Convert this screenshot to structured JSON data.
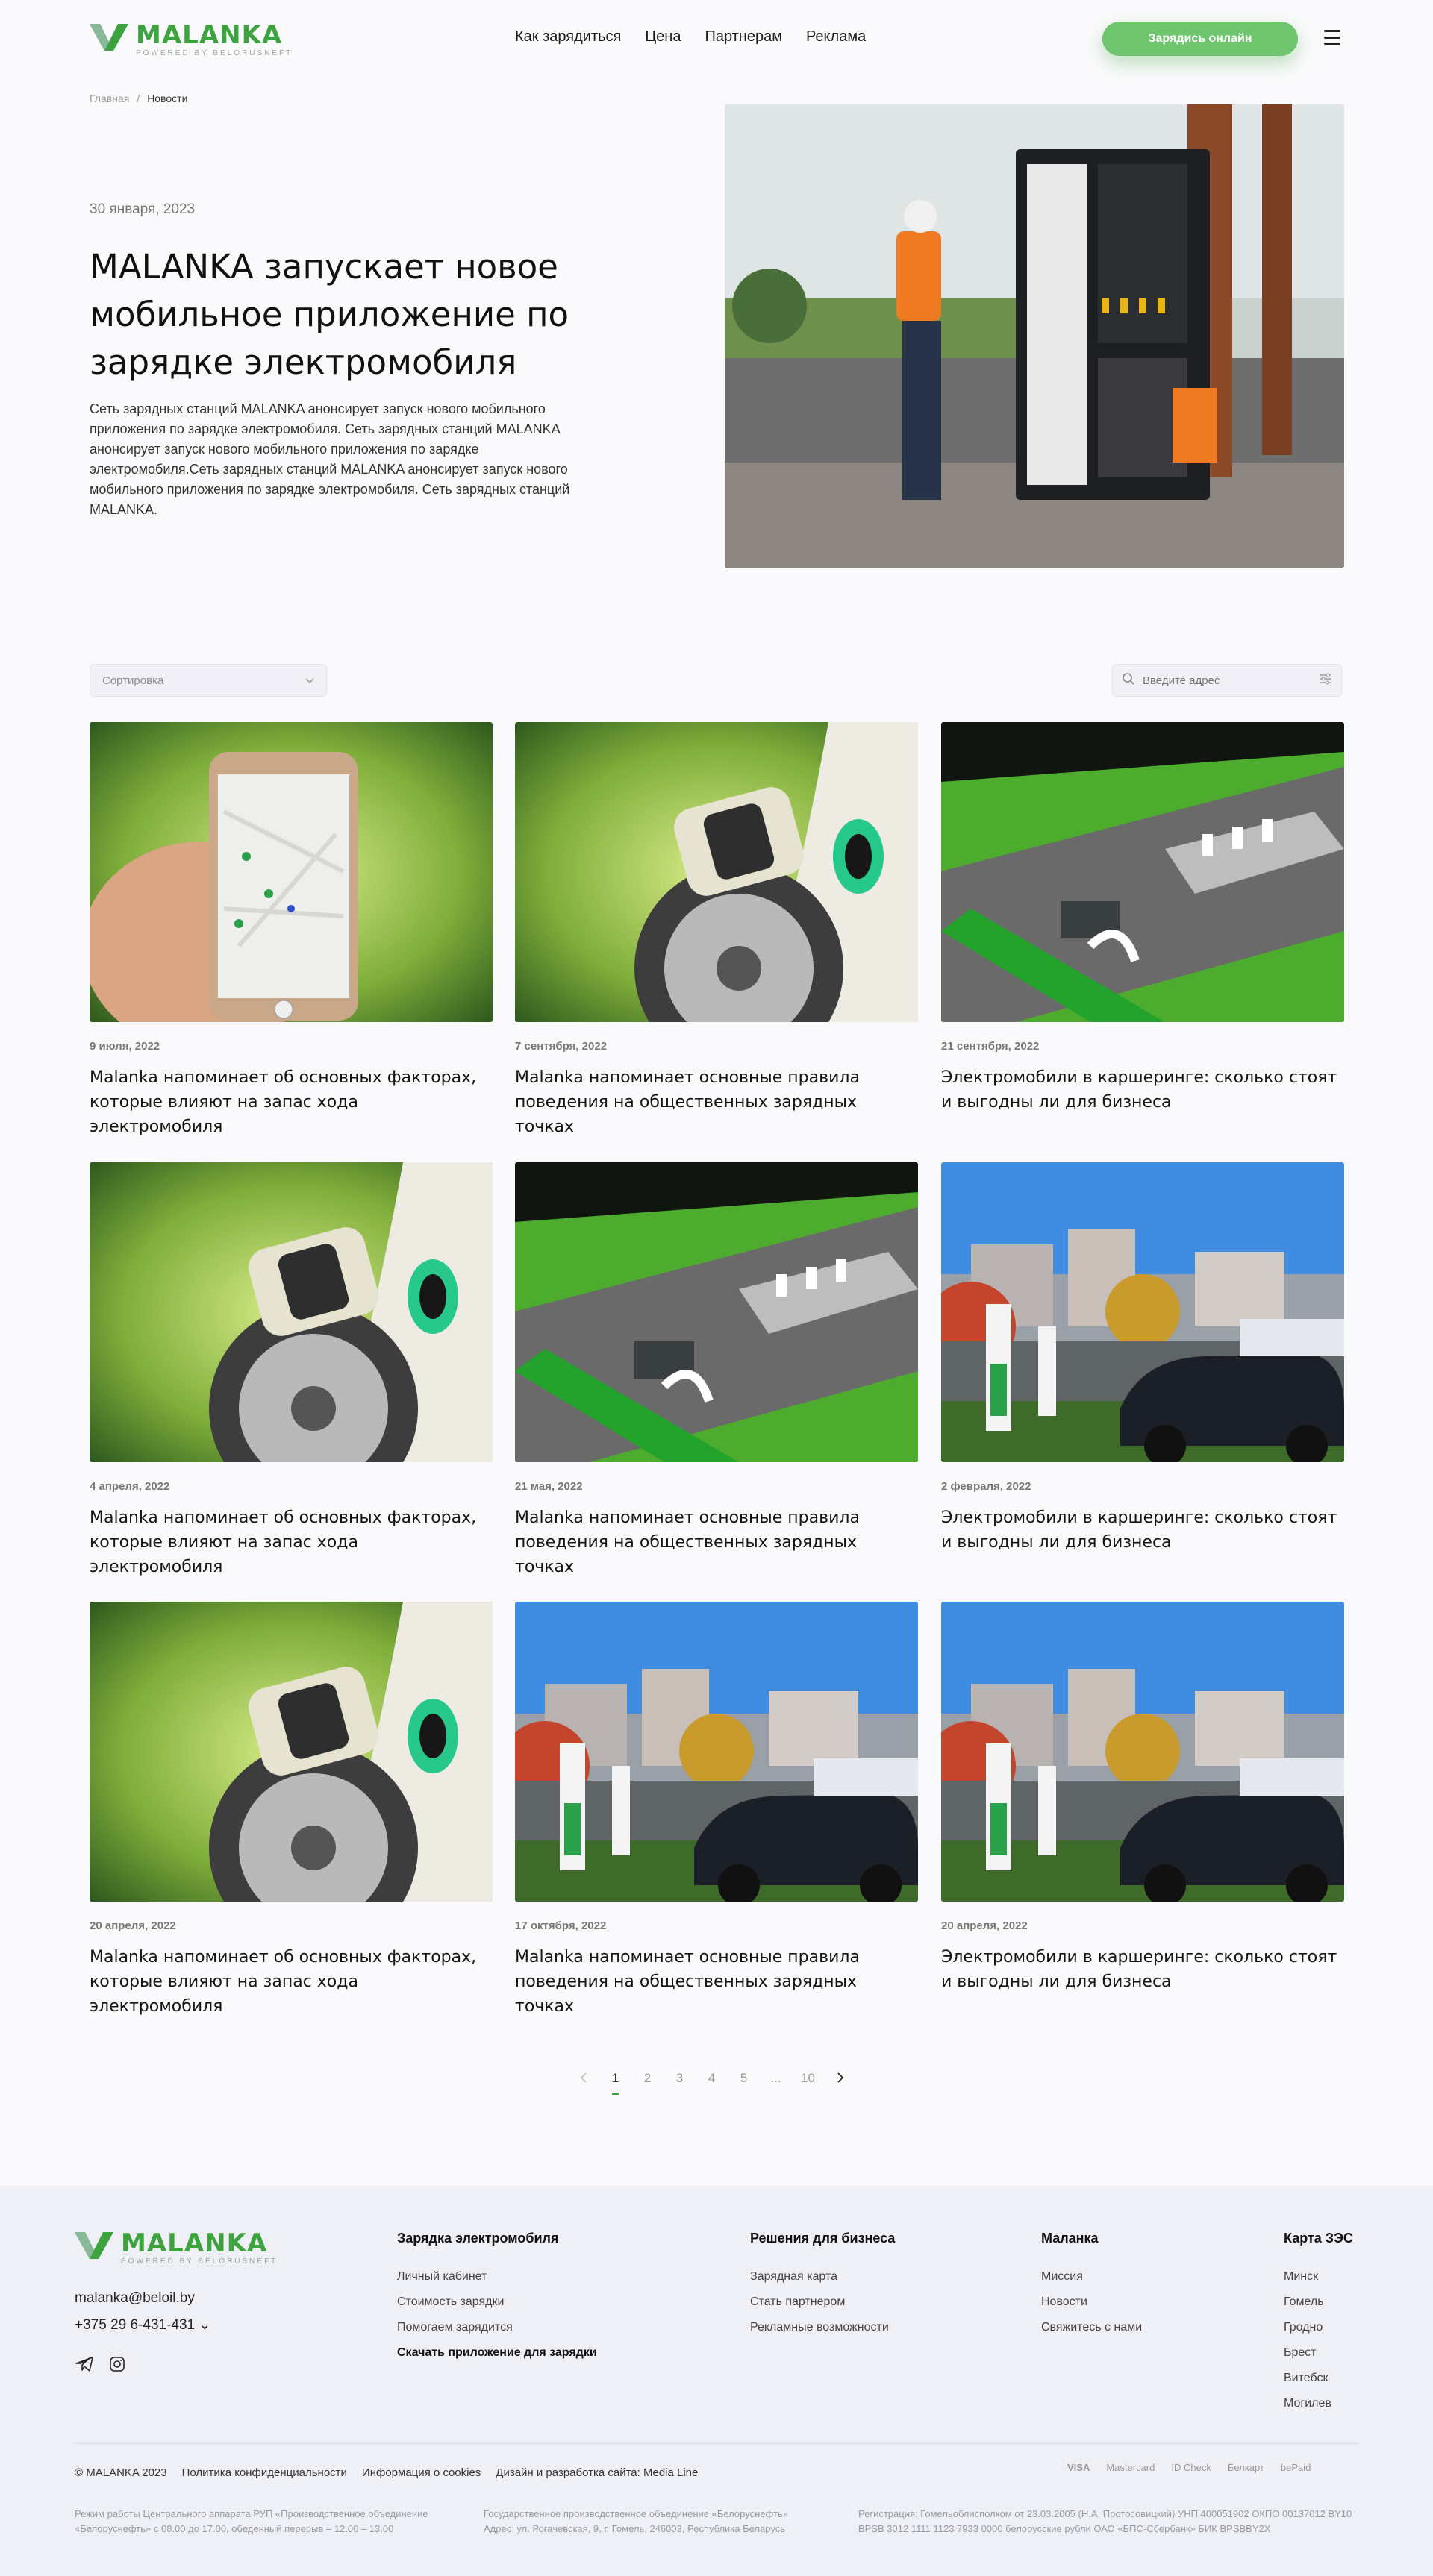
{
  "brand": {
    "name": "MALANKA",
    "tagline": "POWERED BY BELORUSNEFT",
    "green": "#3ca33f",
    "green_light": "#6fc46e"
  },
  "header": {
    "nav": [
      "Как зарядиться",
      "Цена",
      "Партнерам",
      "Реклама"
    ],
    "cta": "Зарядись онлайн",
    "menu_icon": "hamburger-icon"
  },
  "breadcrumb": {
    "home": "Главная",
    "separator": "/",
    "current": "Новости"
  },
  "hero": {
    "date": "30 января, 2023",
    "title": "MALANKA запускает новое мобильное приложение по зарядке электромобиля",
    "text": "Сеть зарядных станций MALANKA анонсирует запуск нового мобильного приложения по зарядке электромобиля. Сеть зарядных станций MALANKA анонсирует запуск нового мобильного приложения по зарядке электромобиля.Сеть зарядных станций MALANKA анонсирует запуск нового мобильного приложения по зарядке электромобиля. Сеть зарядных станций MALANKA."
  },
  "filters": {
    "sort_label": "Сортировка",
    "search_placeholder": "Введите адрес"
  },
  "cards": [
    {
      "date": "9 июля, 2022",
      "title": "Malanka напоминает об основных факторах, которые влияют на запас хода электромобиля",
      "image": "phone-map"
    },
    {
      "date": "7 сентября, 2022",
      "title": "Malanka напоминает основные правила поведения на общественных зарядных точках",
      "image": "charging-plug"
    },
    {
      "date": "21 сентября, 2022",
      "title": "Электромобили в каршеринге: сколько стоят и выгодны ли для бизнеса",
      "image": "station-render"
    },
    {
      "date": "4 апреля, 2022",
      "title": "Malanka напоминает об основных факторах, которые влияют на запас хода электромобиля",
      "image": "charging-plug"
    },
    {
      "date": "21 мая, 2022",
      "title": "Malanka напоминает основные правила поведения на общественных зарядных точках",
      "image": "station-render"
    },
    {
      "date": "2 февраля, 2022",
      "title": "Электромобили в каршеринге: сколько стоят и выгодны ли для бизнеса",
      "image": "street-chargers"
    },
    {
      "date": "20 апреля, 2022",
      "title": "Malanka напоминает об основных факторах, которые влияют на запас хода электромобиля",
      "image": "charging-plug"
    },
    {
      "date": "17 октября, 2022",
      "title": "Malanka напоминает основные правила поведения на общественных зарядных точках",
      "image": "street-chargers"
    },
    {
      "date": "20 апреля, 2022",
      "title": "Электромобили в каршеринге: сколько стоят и выгодны ли для бизнеса",
      "image": "street-chargers"
    }
  ],
  "pagination": {
    "pages": [
      "1",
      "2",
      "3",
      "4",
      "5",
      "...",
      "10"
    ],
    "current": "1"
  },
  "footer": {
    "email": "malanka@beloil.by",
    "phone": "+375 29 6-431-431",
    "social": [
      "telegram-icon",
      "instagram-icon"
    ],
    "columns": [
      {
        "title": "Зарядка электромобиля",
        "links": [
          "Личный кабинет",
          "Стоимость зарядки",
          "Помогаем зарядится",
          "Скачать приложение для зарядки"
        ]
      },
      {
        "title": "Решения для бизнеса",
        "links": [
          "Зарядная карта",
          "Стать партнером",
          "Рекламные возможности"
        ]
      },
      {
        "title": "Маланка",
        "links": [
          "Миссия",
          "Новости",
          "Свяжитесь с нами"
        ]
      },
      {
        "title": "Карта ЗЭС",
        "links": [
          "Минск",
          "Гомель",
          "Гродно",
          "Брест",
          "Витебск",
          "Могилев"
        ]
      }
    ],
    "bottom": [
      "© MALANKA 2023",
      "Политика конфиденциальности",
      "Информация о cookies",
      "Дизайн и разработка сайта: Media Line"
    ],
    "payments": [
      "VISA",
      "Mastercard",
      "ID Check",
      "Белкарт",
      "bePaid"
    ],
    "legal": [
      "Режим работы Центрального аппарата РУП «Производственное объединение «Белоруснефть» с 08.00 до 17.00, обеденный перерыв – 12.00 – 13.00",
      "Государственное производственное объединение «Белоруснефть» Адрес: ул. Рогачевская, 9, г. Гомель, 246003, Республика Беларусь",
      "Регистрация: Гомельоблисполком от 23.03.2005 (Н.А. Протосовицкий) УНП 400051902 ОКПО 00137012 BY10 BPSB 3012 1111 1123 7933 0000 белорусские рубли ОАО «БПС-Сбербанк» БИК BPSBBY2X"
    ]
  }
}
